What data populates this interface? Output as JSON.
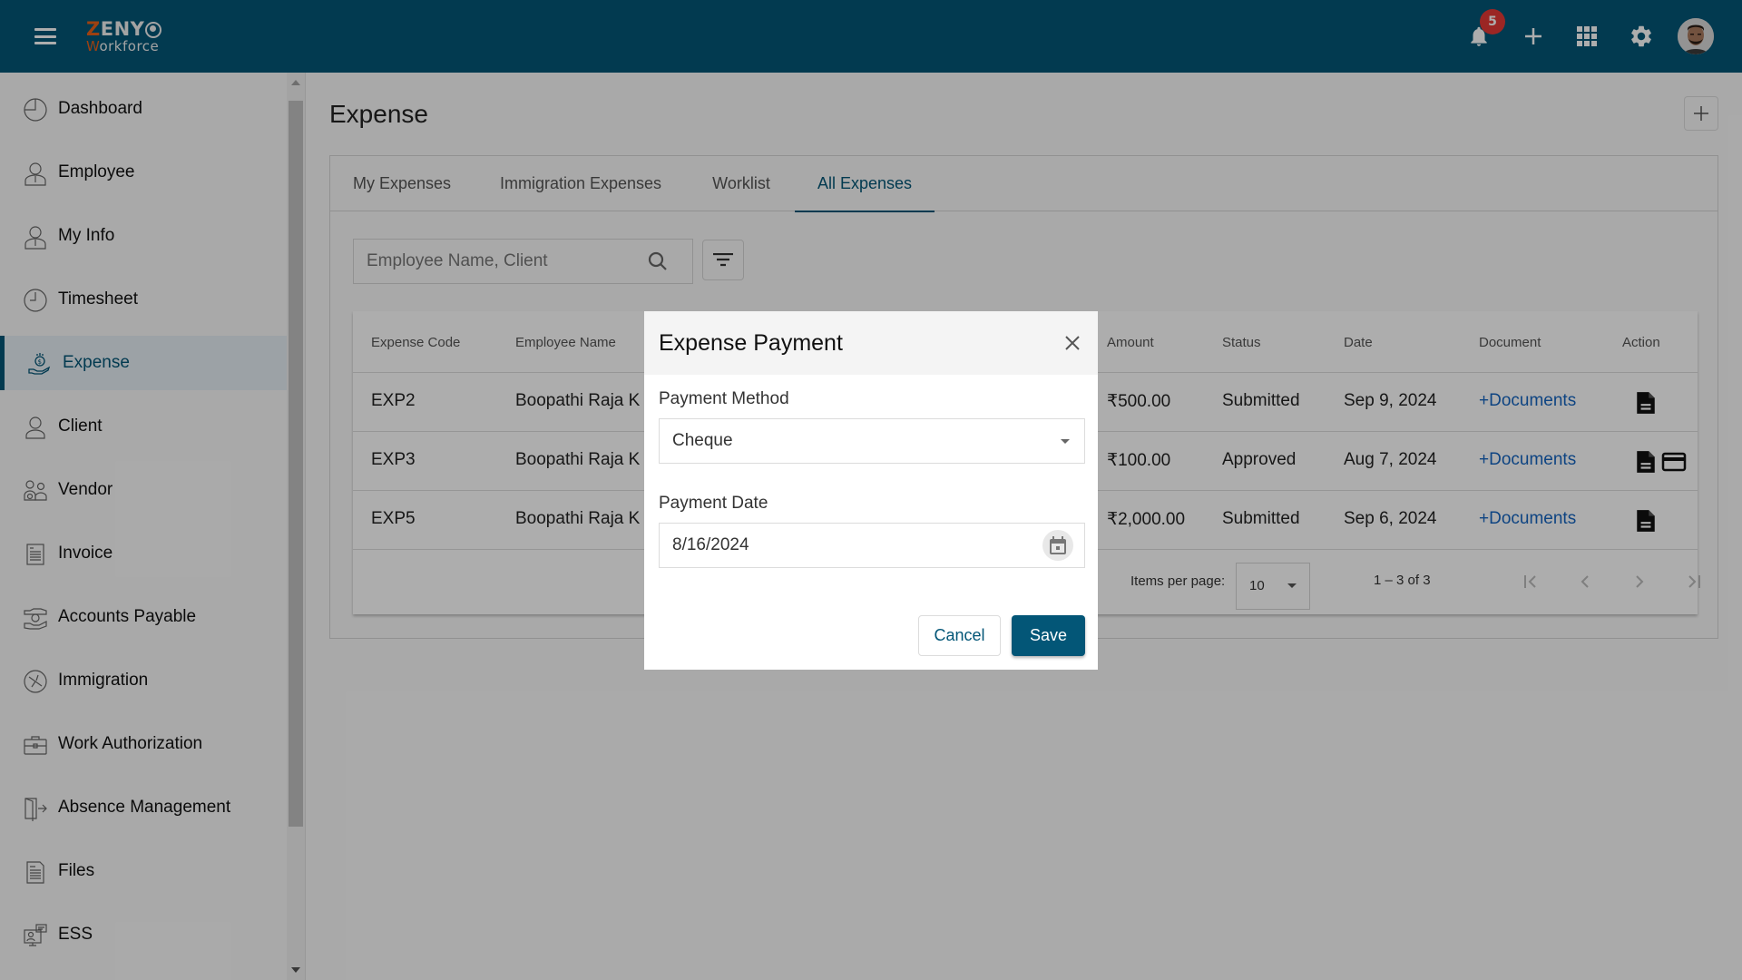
{
  "app": {
    "logo_line1_prefix": "Z",
    "logo_line1_rest": "ENY",
    "logo_line2_prefix": "W",
    "logo_line2_rest": "orkforce",
    "notification_count": "5",
    "brand_color": "#035677",
    "accent_color": "#e8611a"
  },
  "header_icons": [
    "menu-icon",
    "bell-icon",
    "plus-icon",
    "apps-grid-icon",
    "gear-icon",
    "user-avatar"
  ],
  "sidebar": {
    "items": [
      {
        "label": "Dashboard",
        "icon": "pie-chart-icon",
        "active": false
      },
      {
        "label": "Employee",
        "icon": "employee-icon",
        "active": false
      },
      {
        "label": "My Info",
        "icon": "user-info-icon",
        "active": false
      },
      {
        "label": "Timesheet",
        "icon": "clock-icon",
        "active": false
      },
      {
        "label": "Expense",
        "icon": "hand-money-icon",
        "active": true
      },
      {
        "label": "Client",
        "icon": "person-icon",
        "active": false
      },
      {
        "label": "Vendor",
        "icon": "vendor-icon",
        "active": false
      },
      {
        "label": "Invoice",
        "icon": "invoice-icon",
        "active": false
      },
      {
        "label": "Accounts Payable",
        "icon": "accounts-payable-icon",
        "active": false
      },
      {
        "label": "Immigration",
        "icon": "airplane-icon",
        "active": false
      },
      {
        "label": "Work Authorization",
        "icon": "briefcase-icon",
        "active": false
      },
      {
        "label": "Absence Management",
        "icon": "door-exit-icon",
        "active": false
      },
      {
        "label": "Files",
        "icon": "file-icon",
        "active": false
      },
      {
        "label": "ESS",
        "icon": "monitor-chat-icon",
        "active": false
      }
    ]
  },
  "page": {
    "title": "Expense",
    "tabs": [
      {
        "label": "My Expenses",
        "active": false
      },
      {
        "label": "Immigration Expenses",
        "active": false
      },
      {
        "label": "Worklist",
        "active": false
      },
      {
        "label": "All Expenses",
        "active": true
      }
    ],
    "search": {
      "placeholder": "Employee Name, Client",
      "value": ""
    }
  },
  "table": {
    "columns": [
      "Expense Code",
      "Employee Name",
      "Amount",
      "Status",
      "Date",
      "Document",
      "Action"
    ],
    "rows": [
      {
        "code": "EXP2",
        "employee": "Boopathi Raja K",
        "amount": "₹500.00",
        "status": "Submitted",
        "date": "Sep 9, 2024",
        "document": "+Documents",
        "actions": [
          "document-icon"
        ]
      },
      {
        "code": "EXP3",
        "employee": "Boopathi Raja K",
        "amount": "₹100.00",
        "status": "Approved",
        "date": "Aug 7, 2024",
        "document": "+Documents",
        "actions": [
          "document-icon",
          "payment-card-icon"
        ]
      },
      {
        "code": "EXP5",
        "employee": "Boopathi Raja K",
        "amount": "₹2,000.00",
        "status": "Submitted",
        "date": "Sep 6, 2024",
        "document": "+Documents",
        "actions": [
          "document-icon"
        ]
      }
    ],
    "paginator": {
      "items_per_page_label": "Items per page:",
      "items_per_page": "10",
      "range": "1 – 3 of 3"
    }
  },
  "modal": {
    "title": "Expense Payment",
    "payment_method_label": "Payment Method",
    "payment_method_value": "Cheque",
    "payment_date_label": "Payment Date",
    "payment_date_value": "8/16/2024",
    "cancel_label": "Cancel",
    "save_label": "Save"
  }
}
